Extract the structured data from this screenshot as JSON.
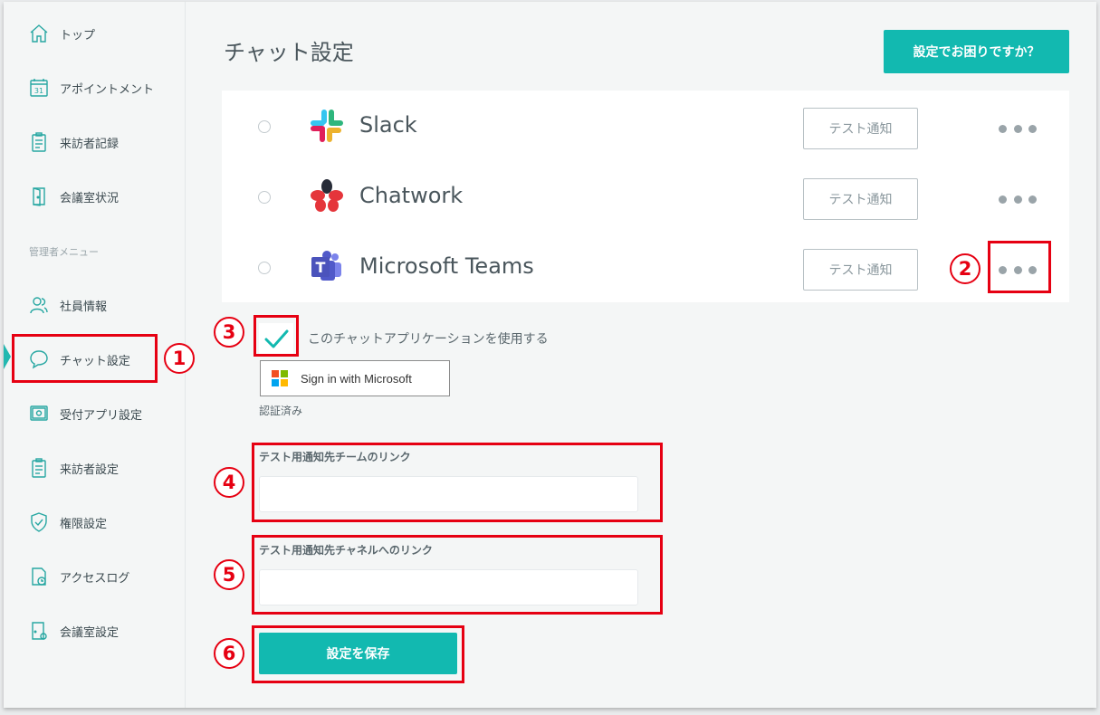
{
  "sidebar": {
    "items": [
      {
        "label": "トップ",
        "icon": "home-icon"
      },
      {
        "label": "アポイントメント",
        "icon": "calendar-icon"
      },
      {
        "label": "来訪者記録",
        "icon": "clipboard-icon"
      },
      {
        "label": "会議室状況",
        "icon": "door-icon"
      }
    ],
    "section_label": "管理者メニュー",
    "admin_items": [
      {
        "label": "社員情報",
        "icon": "users-icon"
      },
      {
        "label": "チャット設定",
        "icon": "chat-icon"
      },
      {
        "label": "受付アプリ設定",
        "icon": "tablet-gear-icon"
      },
      {
        "label": "来訪者設定",
        "icon": "clipboard-icon"
      },
      {
        "label": "権限設定",
        "icon": "shield-icon"
      },
      {
        "label": "アクセスログ",
        "icon": "document-clock-icon"
      },
      {
        "label": "会議室設定",
        "icon": "door-gear-icon"
      }
    ]
  },
  "header": {
    "title": "チャット設定",
    "help_button": "設定でお困りですか？"
  },
  "apps": [
    {
      "name": "Slack",
      "test_label": "テスト通知",
      "logo": "slack-logo"
    },
    {
      "name": "Chatwork",
      "test_label": "テスト通知",
      "logo": "chatwork-logo"
    },
    {
      "name": "Microsoft Teams",
      "test_label": "テスト通知",
      "logo": "teams-logo"
    }
  ],
  "teams_settings": {
    "use_app_label": "このチャットアプリケーションを使用する",
    "use_app_checked": true,
    "sign_in_label": "Sign in with Microsoft",
    "auth_status": "認証済み",
    "team_link_label": "テスト用通知先チームのリンク",
    "team_link_value": "",
    "channel_link_label": "テスト用通知先チャネルへのリンク",
    "channel_link_value": "",
    "save_label": "設定を保存"
  },
  "annotations": [
    "1",
    "2",
    "3",
    "4",
    "5",
    "6"
  ],
  "colors": {
    "accent": "#12b9b0",
    "annotation": "#e60012",
    "icon": "#27a7a2"
  }
}
